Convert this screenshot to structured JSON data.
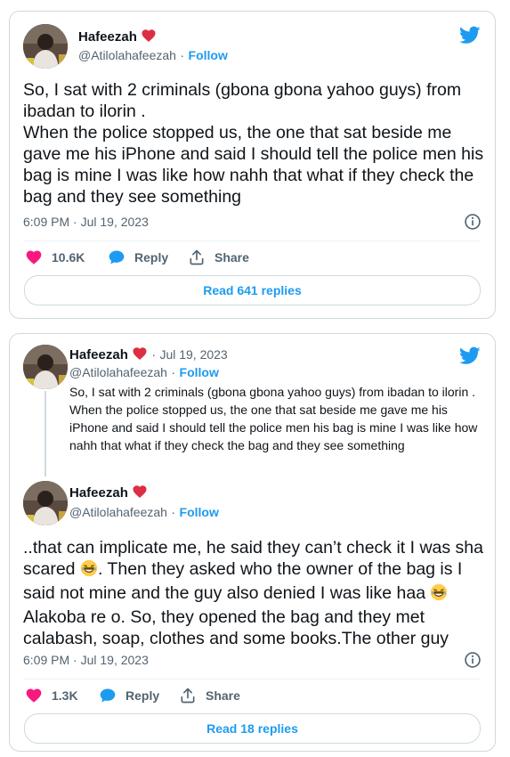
{
  "tweet1": {
    "author_name": "Hafeezah",
    "author_handle": "@Atilolahafeezah",
    "follow_label": "Follow",
    "separator": "·",
    "text": "So, I sat with 2 criminals (gbona gbona yahoo guys) from ibadan to ilorin .\nWhen the police stopped us, the one that sat beside me gave me his iPhone and said I should tell the police men his bag is mine I was like how nahh that what if they check the bag and they see something",
    "timestamp": "6:09 PM · Jul 19, 2023",
    "likes": "10.6K",
    "reply_label": "Reply",
    "share_label": "Share",
    "read_replies": "Read 641 replies"
  },
  "tweet2": {
    "parent": {
      "author_name": "Hafeezah",
      "date": "Jul 19, 2023",
      "author_handle": "@Atilolahafeezah",
      "follow_label": "Follow",
      "text": "So, I sat with 2 criminals (gbona gbona yahoo guys) from ibadan to ilorin .\nWhen the police stopped us, the one that sat beside me gave me his iPhone and said I should tell the police men his bag is mine I was like how nahh that what if they check the bag and they see something"
    },
    "author_name": "Hafeezah",
    "author_handle": "@Atilolahafeezah",
    "follow_label": "Follow",
    "separator": "·",
    "text_part1": "..that can implicate me, he said they can’t check it I was sha scared ",
    "text_part2": ". Then they asked who the owner of the bag is I said not mine and the guy also denied I was like haa ",
    "text_part3": " Alakoba re o. So, they opened the bag and they met calabash, soap, clothes and some books.The other guy",
    "timestamp": "6:09 PM · Jul 19, 2023",
    "likes": "1.3K",
    "reply_label": "Reply",
    "share_label": "Share",
    "read_replies": "Read 18 replies"
  },
  "colors": {
    "accent": "#1d9bf0",
    "like": "#f91880",
    "text": "#0f1419",
    "muted": "#536471",
    "border": "#cfd9de"
  },
  "icons": [
    "twitter-bird-icon",
    "red-heart-emoji-icon",
    "like-heart-icon",
    "reply-bubble-icon",
    "share-upload-icon",
    "info-icon",
    "laughing-tears-emoji-icon"
  ]
}
